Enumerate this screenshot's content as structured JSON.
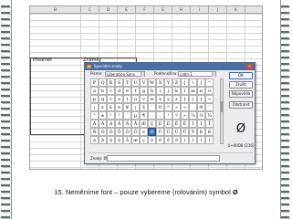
{
  "spreadsheet": {
    "columns": [
      "B",
      "C",
      "D",
      "E",
      "F",
      "G",
      "H",
      "I",
      "J",
      "K"
    ],
    "cells": {
      "predmet": "Předmět",
      "znamky": "Známky"
    }
  },
  "dialog": {
    "title": "Speciální znaky",
    "font_label": "Písmo:",
    "font_value": "Liberation Sans",
    "subset_label": "Podmnožina:",
    "subset_value": "Latin-1",
    "characters": [
      [
        "P",
        "Q",
        "R",
        "S",
        "T",
        "U",
        "V",
        "W",
        "X",
        "Y",
        "Z",
        "[",
        "\\",
        "]",
        "^"
      ],
      [
        "a",
        "b",
        "c",
        "d",
        "e",
        "f",
        "g",
        "h",
        "i",
        "j",
        "k",
        "l",
        "m",
        "n",
        "o"
      ],
      [
        "p",
        "q",
        "r",
        "s",
        "t",
        "u",
        "v",
        "w",
        "x",
        "y",
        "z",
        "{",
        "|",
        "}",
        "~"
      ],
      [
        "¡",
        "¢",
        "£",
        "¤",
        "¥",
        "¦",
        "§",
        "¨",
        "©",
        "ª",
        "«",
        "¬",
        "­",
        "®",
        "¯"
      ],
      [
        "°",
        "±",
        "²",
        "³",
        "´",
        "µ",
        "¶",
        "·",
        "¸",
        "¹",
        "º",
        "»",
        "¼",
        "½",
        "¾"
      ],
      [
        "À",
        "Á",
        "Â",
        "Ã",
        "Ä",
        "Å",
        "Æ",
        "Ç",
        "È",
        "É",
        "Ê",
        "Ë",
        "Ì",
        "Í",
        "Î"
      ],
      [
        "Ñ",
        "Ò",
        "Ó",
        "Ô",
        "Õ",
        "Ö",
        "×",
        "Ø",
        "Ù",
        "Ú",
        "Û",
        "Ü",
        "Ý",
        "Þ",
        "ß"
      ],
      [
        "á",
        "â",
        "ã",
        "ä",
        "å",
        "æ",
        "ç",
        "è",
        "é",
        "ê",
        "ë",
        "ì",
        "í",
        "î",
        "ï"
      ]
    ],
    "selected": {
      "row": 6,
      "col": 7
    },
    "buttons": {
      "ok": "OK",
      "cancel": "Zrušit",
      "help": "Nápověda",
      "delete": "Odstranit"
    },
    "preview_char": "Ø",
    "unicode_label": "U+00D8 (216)",
    "chars_label": "Znaky: Ø",
    "chars_value": ""
  },
  "caption": {
    "text": "15. Neměníme font – pouze vybereme (rolováním) symbol ",
    "symbol": "Ø"
  }
}
